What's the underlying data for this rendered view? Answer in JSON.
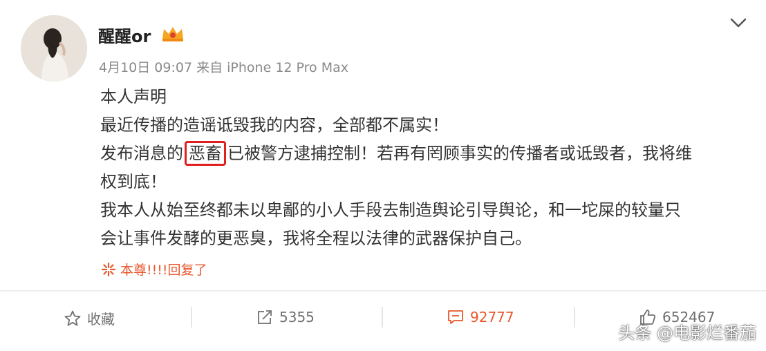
{
  "post": {
    "username": "醒醒or",
    "badge_icon": "crown-badge-icon",
    "meta": "4月10日 09:07 来自 iPhone 12 Pro Max",
    "lines": [
      "本人声明",
      "最近传播的造谣诋毁我的内容，全部都不属实！",
      "",
      "权到底！",
      "我本人从始至终都未以卑鄙的小人手段去制造舆论引导舆论，和一坨屎的较量只",
      "会让事件发酵的更恶臭，我将全程以法律的武器保护自己。"
    ],
    "line3": {
      "before": "发布消息的",
      "highlight": "恶畜",
      "after": "已被警方逮捕控制！若再有罔顾事实的传播者或诋毁者，我将维"
    },
    "reply_note": "本尊!!!!回复了"
  },
  "actions": {
    "favorite_label": "收藏",
    "repost_count": "5355",
    "comment_count": "92777",
    "like_count": "652467"
  },
  "watermark": "头条 @电影烂番茄",
  "colors": {
    "accent": "#e8562b",
    "highlight_border": "#e02020",
    "meta_text": "#8a8a8a"
  }
}
